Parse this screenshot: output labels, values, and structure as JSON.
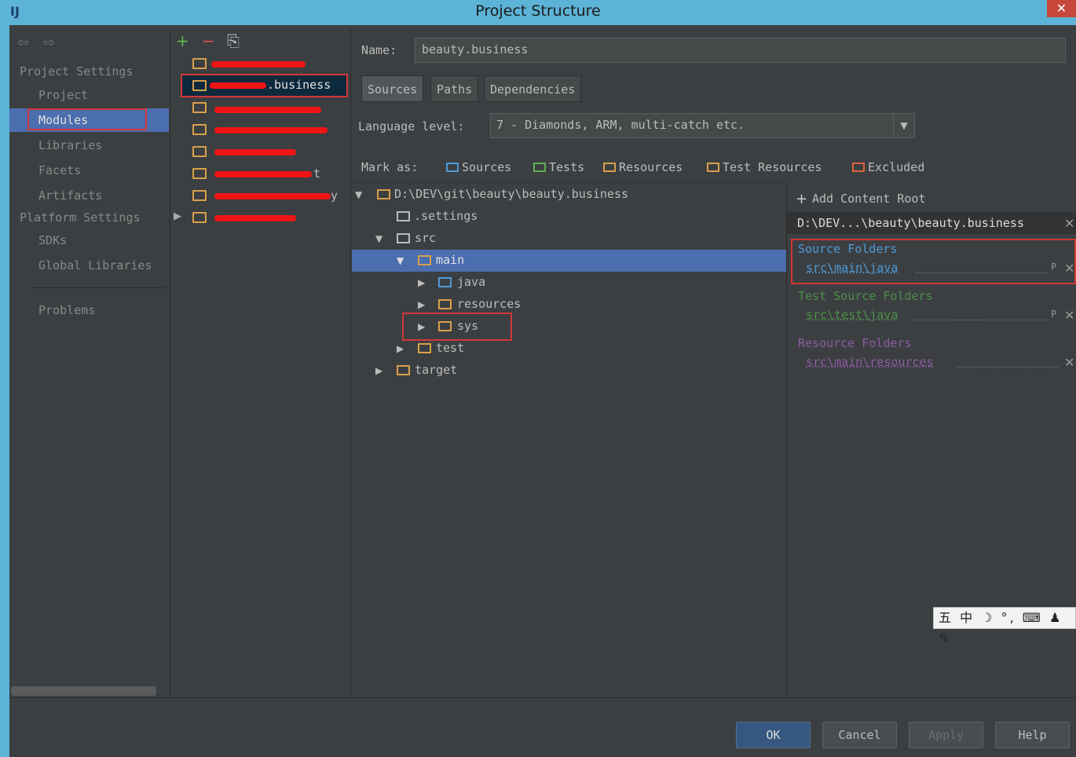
{
  "window": {
    "title": "Project Structure",
    "logo": "IJ",
    "close": "✕"
  },
  "nav": {
    "project_settings": "Project Settings",
    "items_project": [
      "Project",
      "Modules",
      "Libraries",
      "Facets",
      "Artifacts"
    ],
    "platform_settings": "Platform Settings",
    "items_platform": [
      "SDKs",
      "Global Libraries"
    ],
    "problems": "Problems",
    "selected": "Modules"
  },
  "modules": {
    "toolbar": {
      "add": "+",
      "remove": "−",
      "copy": "⎘"
    },
    "selected_visible_text": ".business",
    "rows_partially_visible": [
      "",
      ".business",
      "",
      "",
      "",
      "t",
      "y",
      ""
    ]
  },
  "module_details": {
    "name_label": "Name:",
    "name_value": "beauty.business",
    "tabs": [
      "Sources",
      "Paths",
      "Dependencies"
    ],
    "active_tab": "Sources",
    "language_label": "Language level:",
    "language_value": "7 - Diamonds, ARM, multi-catch etc.",
    "mark_as_label": "Mark as:",
    "mark_as": [
      {
        "label": "Sources",
        "color": "#4f9ad8"
      },
      {
        "label": "Tests",
        "color": "#5fad56"
      },
      {
        "label": "Resources",
        "color": "#d9a04a"
      },
      {
        "label": "Test Resources",
        "color": "#d9a04a"
      },
      {
        "label": "Excluded",
        "color": "#e0603f"
      }
    ]
  },
  "tree": {
    "root": "D:\\DEV\\git\\beauty\\beauty.business",
    "settings": ".settings",
    "src": "src",
    "main": "main",
    "java": "java",
    "resources": "resources",
    "sys": "sys",
    "test": "test",
    "target": "target"
  },
  "content_roots": {
    "add_label": "Add Content Root",
    "root_path": "D:\\DEV...\\beauty\\beauty.business",
    "source_folders": {
      "title": "Source Folders",
      "path": "src\\main\\java",
      "color": "#4f9ad8"
    },
    "test_source_folders": {
      "title": "Test Source Folders",
      "path": "src\\test\\java",
      "color": "#4a8f4a"
    },
    "resource_folders": {
      "title": "Resource Folders",
      "path": "src\\main\\resources",
      "color": "#8d5ba1"
    }
  },
  "ime": {
    "text": "五 中 ☽ °, ⌨ ♟ ✎"
  },
  "footer": {
    "ok": "OK",
    "cancel": "Cancel",
    "apply": "Apply",
    "help": "Help"
  }
}
